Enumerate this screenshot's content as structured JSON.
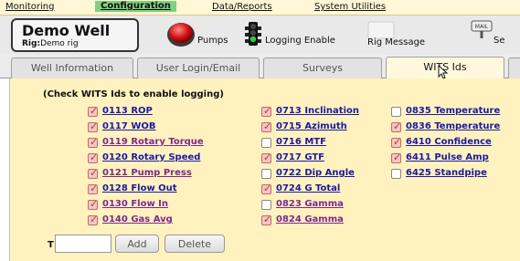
{
  "menu": {
    "items": [
      {
        "label": "Monitoring"
      },
      {
        "label": "Configuration"
      },
      {
        "label": "Data/Reports"
      },
      {
        "label": "System Utilities"
      }
    ]
  },
  "header": {
    "title": "Demo Well",
    "rig_prefix": "Rig:",
    "rig_name": "Demo rig",
    "tools": {
      "pumps": "Pumps",
      "logging_enable": "Logging Enable",
      "rig_message": "Rig Message",
      "se": "Se"
    },
    "icons": {
      "pumps": "red-stop-button-icon",
      "logging": "traffic-light-icon",
      "rig_message": "message-icon",
      "settings": "mail-sign-icon"
    }
  },
  "tabs": [
    {
      "label": "Well Information"
    },
    {
      "label": "User Login/Email"
    },
    {
      "label": "Surveys"
    },
    {
      "label": "WITS Ids",
      "selected": true
    }
  ],
  "wits": {
    "heading": "(Check WITS Ids to enable logging)",
    "col1": [
      {
        "label": "0113 ROP",
        "checked": true,
        "visited": false
      },
      {
        "label": "0117 WOB",
        "checked": true,
        "visited": false
      },
      {
        "label": "0119 Rotary Torque",
        "checked": true,
        "visited": true
      },
      {
        "label": "0120 Rotary Speed",
        "checked": true,
        "visited": false
      },
      {
        "label": "0121 Pump Press",
        "checked": true,
        "visited": true
      },
      {
        "label": "0128 Flow Out",
        "checked": true,
        "visited": false
      },
      {
        "label": "0130 Flow In",
        "checked": true,
        "visited": true
      },
      {
        "label": "0140 Gas Avg",
        "checked": true,
        "visited": true
      }
    ],
    "col2": [
      {
        "label": "0713 Inclination",
        "checked": true,
        "visited": false
      },
      {
        "label": "0715 Azimuth",
        "checked": true,
        "visited": false
      },
      {
        "label": "0716 MTF",
        "checked": false,
        "visited": false
      },
      {
        "label": "0717 GTF",
        "checked": true,
        "visited": false
      },
      {
        "label": "0722 Dip Angle",
        "checked": false,
        "visited": false
      },
      {
        "label": "0724 G Total",
        "checked": true,
        "visited": false
      },
      {
        "label": "0823 Gamma",
        "checked": false,
        "visited": true
      },
      {
        "label": "0824 Gamma",
        "checked": true,
        "visited": true
      }
    ],
    "col3": [
      {
        "label": "0835 Temperature",
        "checked": false,
        "visited": false
      },
      {
        "label": "0836 Temperature",
        "checked": true,
        "visited": false
      },
      {
        "label": "6410 Confidence",
        "checked": true,
        "visited": false
      },
      {
        "label": "6411 Pulse Amp",
        "checked": true,
        "visited": false
      },
      {
        "label": "6425 Standpipe",
        "checked": false,
        "visited": false
      }
    ]
  },
  "footer": {
    "t_label": "T",
    "input_value": "",
    "add_label": "Add",
    "delete_label": "Delete"
  }
}
